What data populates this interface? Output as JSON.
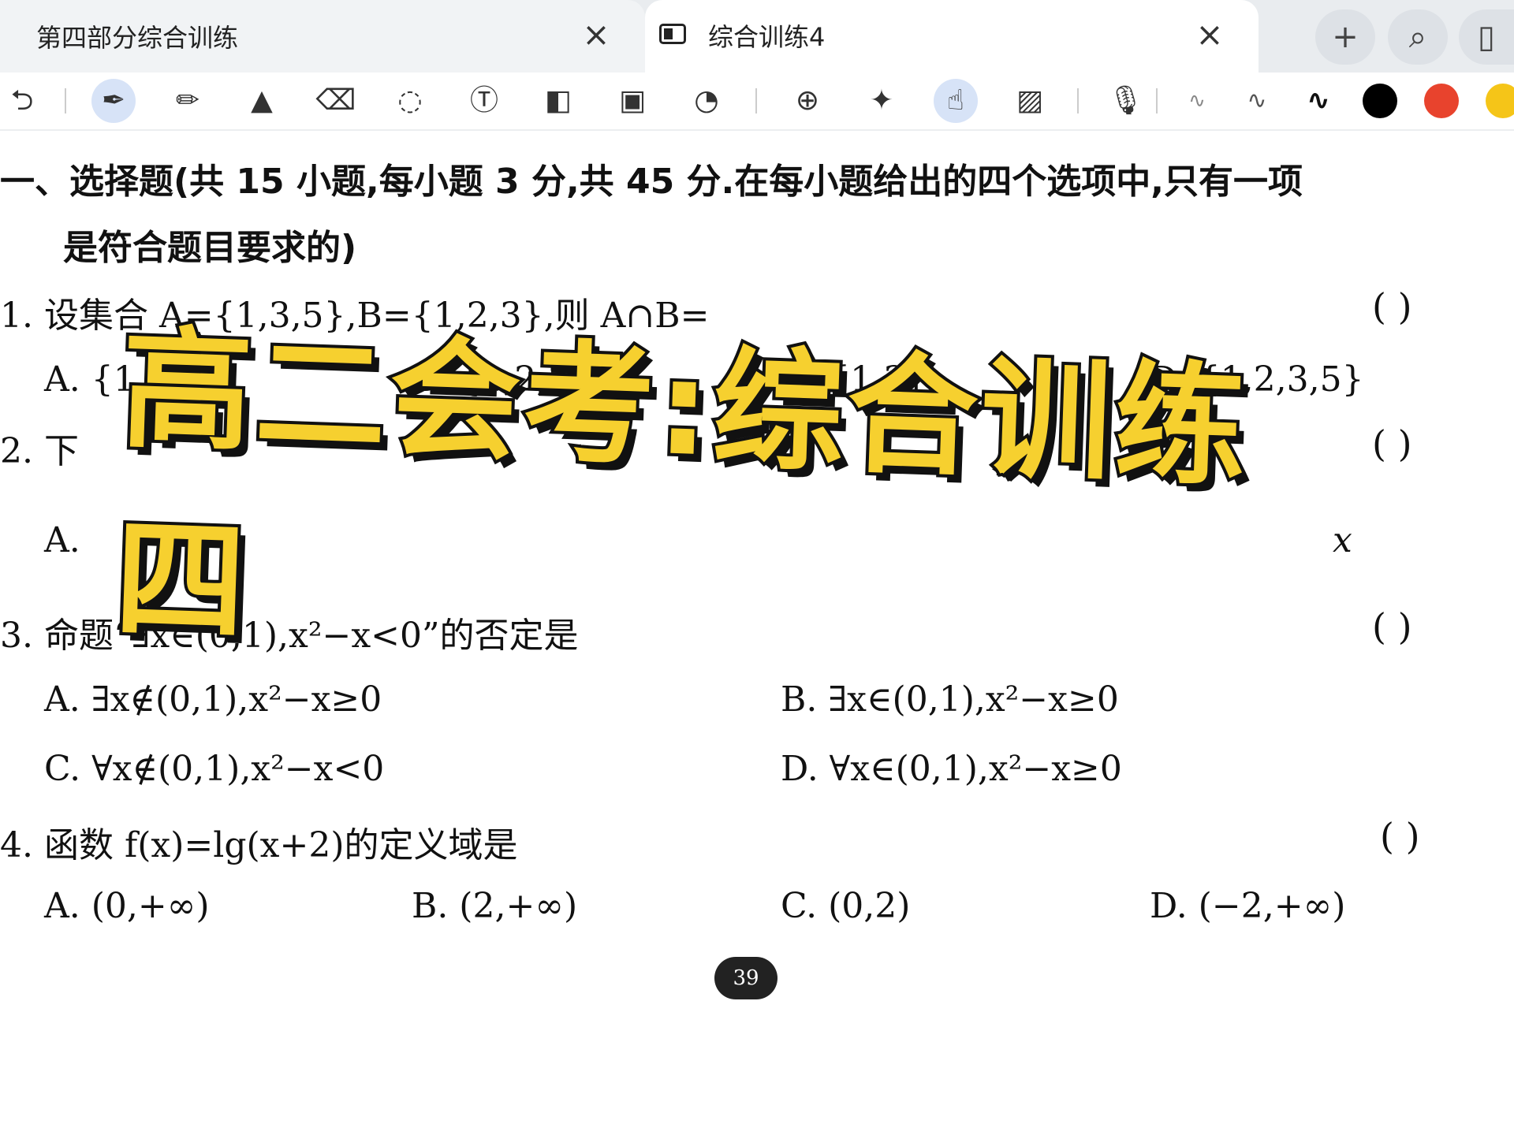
{
  "tabs": [
    {
      "label": "第四部分综合训练",
      "close": "×"
    },
    {
      "label": "综合训练4",
      "close": "×"
    }
  ],
  "tab_actions": {
    "new_tab": "+",
    "search": "⌕",
    "sidebar": "▯"
  },
  "toolbar": {
    "tools": [
      "undo-icon",
      "pen-icon",
      "pencil-icon",
      "highlighter-icon",
      "eraser-icon",
      "lasso-icon",
      "text-icon",
      "shapes-icon",
      "image-icon",
      "sticker-icon",
      "zoom-icon",
      "laser-pointer-icon",
      "hand-touch-icon",
      "hatch-icon",
      "microphone-icon",
      "stroke-thin-icon",
      "stroke-medium-icon",
      "stroke-thick-icon"
    ],
    "colors": [
      "#000000",
      "#e8432d",
      "#f5c518"
    ]
  },
  "document": {
    "section_title": "一、选择题(共 15 小题,每小题 3 分,共 45 分.在每小题给出的四个选项中,只有一项",
    "section_title_cont": "是符合题目要求的)",
    "q1": {
      "stem": "1. 设集合 A={1,3,5},B={1,2,3},则 A∩B=",
      "paren": "(      )",
      "options": [
        "A. {1,3,5}",
        "B. {1,2,3}",
        "C. {1,3}",
        "D. {1,2,3,5}"
      ]
    },
    "q2": {
      "stem": "2. 下",
      "paren": "(      )",
      "option_a": "A.",
      "option_tail": "x"
    },
    "q3": {
      "stem": "3. 命题“∃x∈(0,1),x²−x<0”的否定是",
      "paren": "(      )",
      "options": [
        "A. ∃x∉(0,1),x²−x≥0",
        "B. ∃x∈(0,1),x²−x≥0",
        "C. ∀x∉(0,1),x²−x<0",
        "D. ∀x∈(0,1),x²−x≥0"
      ]
    },
    "q4": {
      "stem": "4. 函数 f(x)=lg(x+2)的定义域是",
      "paren": "(      )",
      "options": [
        "A. (0,+∞)",
        "B. (2,+∞)",
        "C. (0,2)",
        "D. (−2,+∞)"
      ]
    },
    "page_number": "39"
  },
  "banner": {
    "text": "高二会考:综合训练四"
  }
}
